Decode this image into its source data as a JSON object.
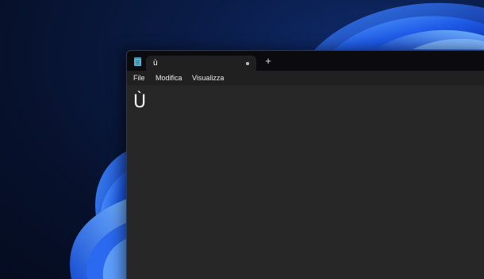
{
  "app": {
    "tab_title": "ù",
    "new_tab_symbol": "+",
    "tab_status": "unsaved-dot"
  },
  "menu": {
    "items": [
      {
        "label": "File"
      },
      {
        "label": "Modifica"
      },
      {
        "label": "Visualizza"
      }
    ]
  },
  "editor": {
    "content": "Ù"
  },
  "colors": {
    "window_bg": "#272727",
    "titlebar_bg": "#0b0b0f",
    "tab_bg": "#202020",
    "menubar_bg": "#202020",
    "text": "#f2f2f2",
    "app_icon": "#55b6d3",
    "wallpaper_blue": "#1f5ce8"
  },
  "icons": {
    "app_icon": "notepad-icon",
    "tab_close": "unsaved-dot-icon",
    "new_tab": "plus-icon"
  }
}
